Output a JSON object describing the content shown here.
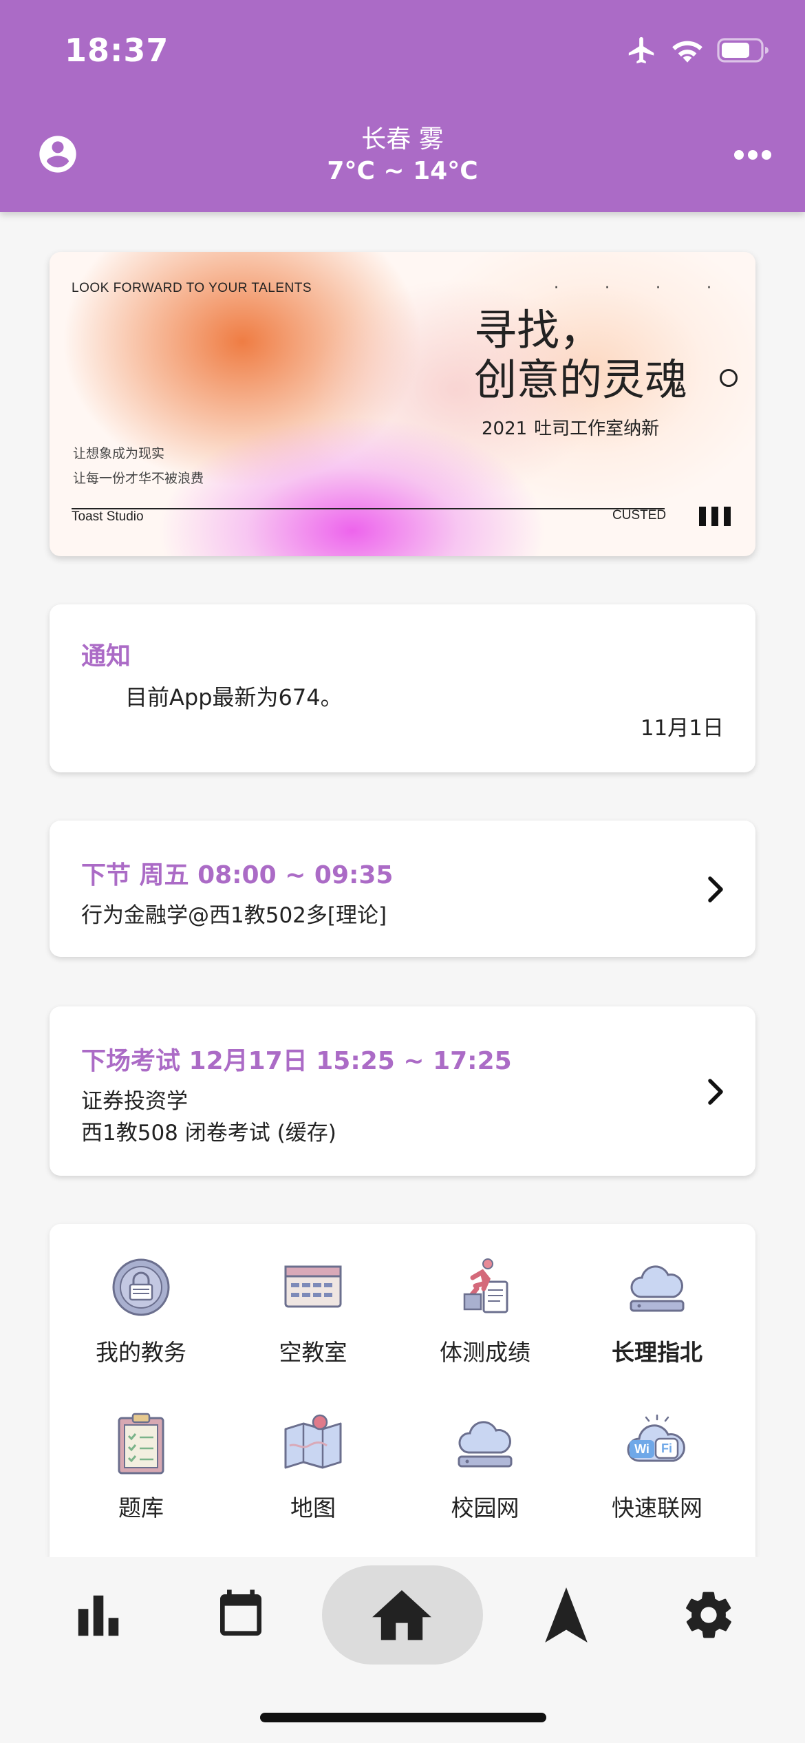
{
  "status_bar": {
    "time": "18:37"
  },
  "header": {
    "city_weather": "长春 雾",
    "temperature": "7°C ~ 14°C"
  },
  "banner": {
    "tagline": "LOOK FORWARD TO YOUR TALENTS",
    "dots": "· · · ·",
    "headline_line1": "寻找，",
    "headline_line2": "创意的灵魂",
    "year": "2021",
    "recruit": "吐司工作室纳新",
    "sub1": "让想象成为现实",
    "sub2": "让每一份才华不被浪费",
    "studio": "Toast Studio",
    "org": "CUSTED"
  },
  "notice": {
    "title": "通知",
    "body": "目前App最新为674。",
    "date": "11月1日"
  },
  "next_class": {
    "title": "下节 周五 08:00 ~ 09:35",
    "detail": "行为金融学@西1教502多[理论]"
  },
  "next_exam": {
    "title": "下场考试 12月17日 15:25 ~ 17:25",
    "course": "证券投资学",
    "detail": "西1教508  闭卷考试 (缓存)"
  },
  "grid": [
    {
      "label": "我的教务",
      "icon": "academic-lock-icon"
    },
    {
      "label": "空教室",
      "icon": "classroom-icon"
    },
    {
      "label": "体测成绩",
      "icon": "running-report-icon"
    },
    {
      "label": "长理指北",
      "icon": "cloud-server-icon"
    },
    {
      "label": "题库",
      "icon": "clipboard-icon"
    },
    {
      "label": "地图",
      "icon": "map-icon"
    },
    {
      "label": "校园网",
      "icon": "cloud-network-icon"
    },
    {
      "label": "快速联网",
      "icon": "wifi-cloud-icon"
    }
  ],
  "bottom_nav": [
    "stats-icon",
    "calendar-icon",
    "home-icon",
    "navigation-icon",
    "settings-icon"
  ],
  "colors": {
    "accent": "#ab6bc6",
    "background": "#f6f6f6"
  }
}
